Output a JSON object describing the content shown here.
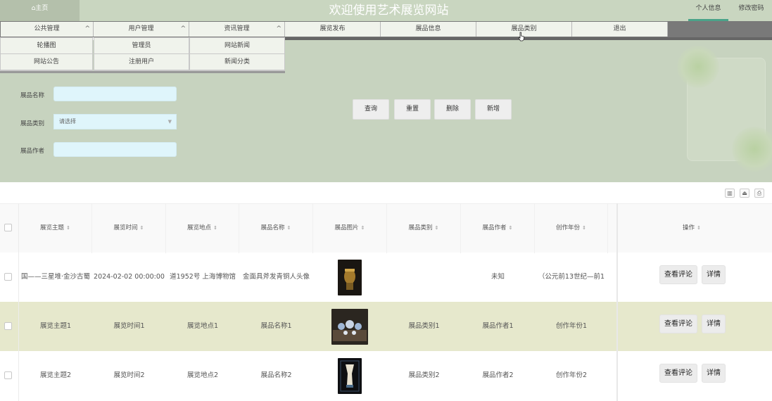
{
  "header": {
    "home_tab": "⌂主页",
    "site_title": "欢迎使用艺术展览网站",
    "user_links": [
      "个人信息",
      "修改密码"
    ]
  },
  "nav": {
    "items": [
      {
        "label": "公共管理",
        "has_dropdown": true,
        "expanded": true
      },
      {
        "label": "用户管理",
        "has_dropdown": true,
        "expanded": true
      },
      {
        "label": "资讯管理",
        "has_dropdown": true,
        "expanded": true
      },
      {
        "label": "展览发布",
        "has_dropdown": false
      },
      {
        "label": "展品信息",
        "has_dropdown": false
      },
      {
        "label": "展品类别",
        "has_dropdown": false
      },
      {
        "label": "退出",
        "has_dropdown": false
      }
    ],
    "chevron": "^",
    "dropdowns": [
      [
        "轮播图",
        "网站公告"
      ],
      [
        "管理员",
        "注册用户"
      ],
      [
        "网站新闻",
        "新闻分类"
      ]
    ]
  },
  "search": {
    "fields": [
      {
        "label": "展品名称",
        "value": ""
      },
      {
        "label": "展品类别",
        "value": "请选择"
      },
      {
        "label": "展品作者",
        "value": ""
      }
    ],
    "buttons": [
      "查询",
      "重置",
      "删除",
      "新增"
    ]
  },
  "toolbar_icons": [
    "columns-icon",
    "export-icon",
    "print-icon"
  ],
  "table": {
    "columns": [
      "展览主题",
      "展览时间",
      "展览地点",
      "展品名称",
      "展品图片",
      "展品类别",
      "展品作者",
      "创作年份",
      "操作"
    ],
    "sort_glyph": "⇕",
    "rows": [
      {
        "theme": "国——三星堆·金沙古蜀",
        "time": "2024-02-02 00:00:00",
        "place": "道1952号 上海博物馆",
        "name": "金面具斧发青铜人头像",
        "category": "",
        "author": "未知",
        "year": "（公元前13世纪—前1",
        "highlight": false
      },
      {
        "theme": "展览主题1",
        "time": "展览时间1",
        "place": "展览地点1",
        "name": "展品名称1",
        "category": "展品类别1",
        "author": "展品作者1",
        "year": "创作年份1",
        "highlight": true
      },
      {
        "theme": "展览主题2",
        "time": "展览时间2",
        "place": "展览地点2",
        "name": "展品名称2",
        "category": "展品类别2",
        "author": "展品作者2",
        "year": "创作年份2",
        "highlight": false
      }
    ],
    "actions": [
      "查看评论",
      "详情"
    ]
  },
  "colors": {
    "topbar": "#c9d6c0",
    "panel": "#c7d3bf",
    "highlight_row": "#e6e8cc",
    "accent_underline": "#4aa389"
  }
}
